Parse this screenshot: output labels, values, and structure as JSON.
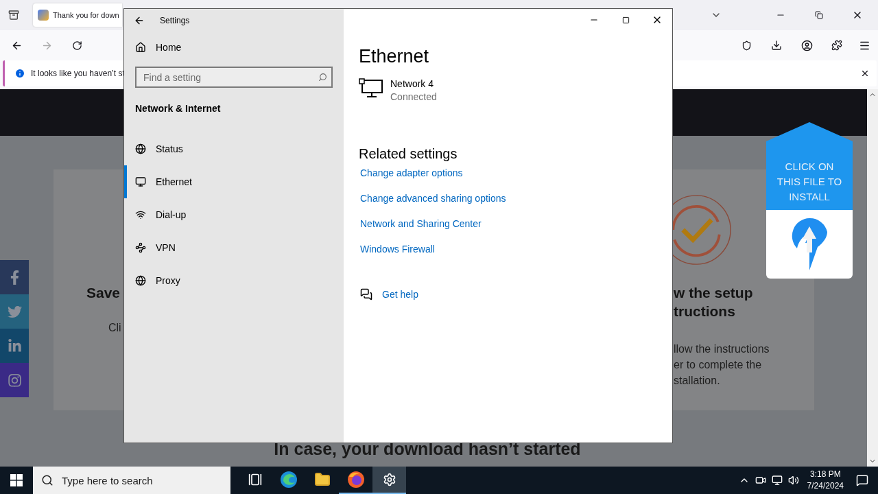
{
  "browser": {
    "tab_title": "Thank you for down",
    "notification": "It looks like you haven’t st"
  },
  "page": {
    "social": [
      {
        "kind": "facebook"
      },
      {
        "kind": "twitter"
      },
      {
        "kind": "linkedin"
      },
      {
        "kind": "instagram"
      }
    ],
    "left_card": {
      "heading": "Save",
      "text": "Cli"
    },
    "right_card": {
      "heading_lines": [
        "w the setup",
        "tructions"
      ],
      "text_lines": [
        "llow the instructions",
        "er to complete the",
        "stallation."
      ]
    },
    "install_callout": {
      "text": "CLICK ON THIS FILE TO INSTALL"
    },
    "footer_heading": "In case, your download hasn’t started"
  },
  "settings": {
    "title": "Settings",
    "home": "Home",
    "search": {
      "placeholder": "Find a setting"
    },
    "section": "Network & Internet",
    "nav": [
      {
        "label": "Status",
        "kind": "status",
        "selected": false
      },
      {
        "label": "Ethernet",
        "kind": "ethernet",
        "selected": true
      },
      {
        "label": "Dial-up",
        "kind": "dialup",
        "selected": false
      },
      {
        "label": "VPN",
        "kind": "vpn",
        "selected": false
      },
      {
        "label": "Proxy",
        "kind": "proxy",
        "selected": false
      }
    ],
    "heading": "Ethernet",
    "network": {
      "name": "Network 4",
      "status": "Connected"
    },
    "related_heading": "Related settings",
    "links": [
      "Change adapter options",
      "Change advanced sharing options",
      "Network and Sharing Center",
      "Windows Firewall"
    ],
    "help": "Get help"
  },
  "taskbar": {
    "search_placeholder": "Type here to search",
    "apps": [
      {
        "kind": "taskview",
        "running": false,
        "selected": false
      },
      {
        "kind": "edge",
        "running": false,
        "selected": false
      },
      {
        "kind": "explorer",
        "running": false,
        "selected": false
      },
      {
        "kind": "firefox",
        "running": true,
        "selected": false
      },
      {
        "kind": "settings",
        "running": true,
        "selected": true
      }
    ],
    "time": "3:18 PM",
    "date": "7/24/2024"
  }
}
